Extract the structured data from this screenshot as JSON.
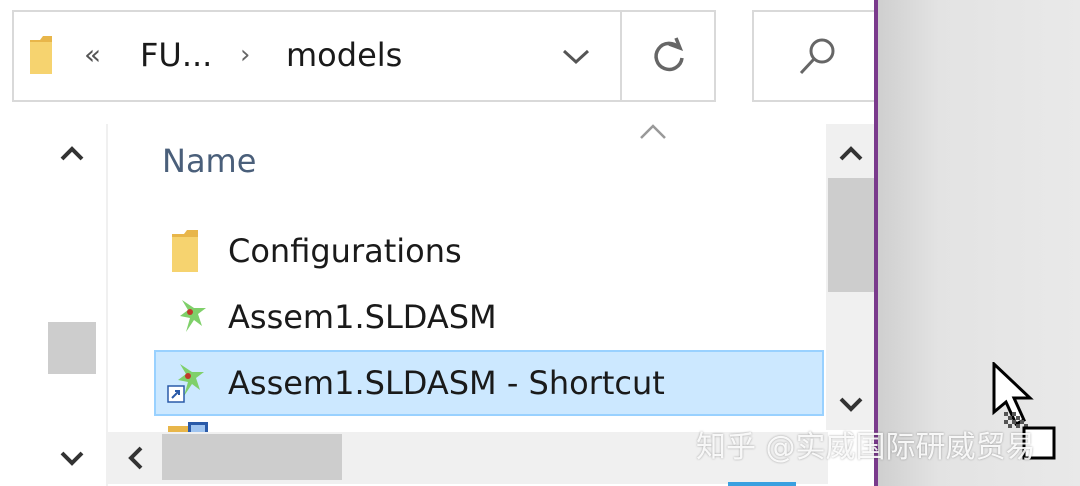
{
  "address_bar": {
    "overflow": "«",
    "crumbs": [
      "FU...",
      "models"
    ],
    "separator": "›"
  },
  "columns": {
    "name": "Name"
  },
  "files": [
    {
      "name": "Configurations",
      "icon": "folder-icon"
    },
    {
      "name": "Assem1.SLDASM",
      "icon": "solidworks-assembly-icon"
    },
    {
      "name": "Assem1.SLDASM - Shortcut",
      "icon": "solidworks-shortcut-icon",
      "selected": true
    }
  ],
  "watermark": "知乎 @实威国际研威贸易",
  "colors": {
    "selection_bg": "#cce8ff",
    "selection_border": "#99d1ff",
    "folder": "#f2c85b",
    "window_edge": "#7a3a8c"
  }
}
